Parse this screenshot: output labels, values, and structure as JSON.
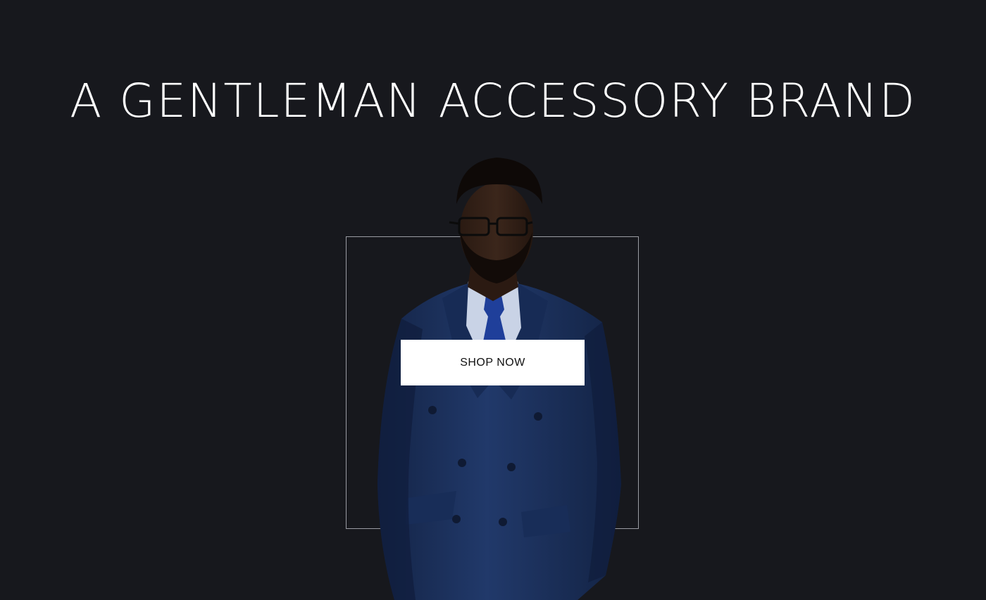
{
  "hero": {
    "headline": "A GENTLEMAN ACCESSORY BRAND",
    "cta_label": "SHOP NOW",
    "image_subject": "man-in-navy-double-breasted-suit",
    "colors": {
      "background": "#17181d",
      "text": "#ffffff",
      "frame_border": "#9a9ca3",
      "button_bg": "#ffffff",
      "button_text": "#111111",
      "suit": "#1c3461"
    }
  }
}
